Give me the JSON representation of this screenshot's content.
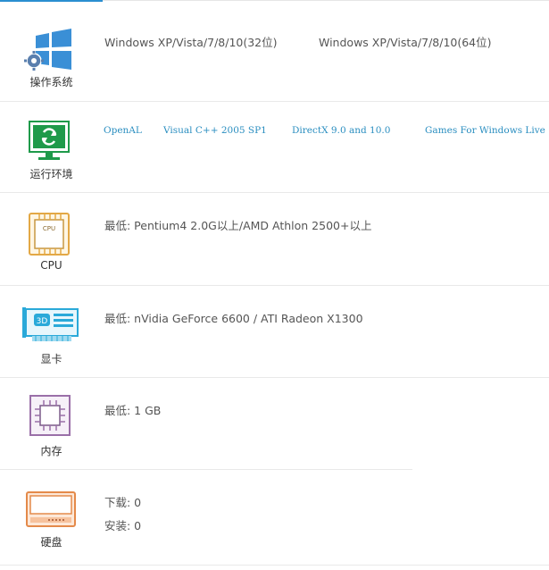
{
  "os": {
    "label": "操作系统",
    "values": [
      "Windows XP/Vista/7/8/10(32位)",
      "Windows XP/Vista/7/8/10(64位)"
    ]
  },
  "runtime": {
    "label": "运行环境",
    "links": [
      "OpenAL",
      "Visual C++ 2005 SP1",
      "DirectX 9.0 and 10.0",
      "Games For Windows Live"
    ]
  },
  "cpu": {
    "label": "CPU",
    "chip_text": "CPU",
    "value": "最低: Pentium4 2.0G以上/AMD Athlon 2500+以上"
  },
  "gpu": {
    "label": "显卡",
    "chip_text": "3D",
    "value": "最低: nVidia GeForce 6600 / ATI Radeon X1300"
  },
  "memory": {
    "label": "内存",
    "value": "最低: 1 GB"
  },
  "disk": {
    "label": "硬盘",
    "download": "下载: 0",
    "install": "安装: 0"
  },
  "colors": {
    "accent": "#2a8fd0",
    "link": "#2a8ec0",
    "os_icon": "#3a8fd6",
    "runtime_icon": "#1f9a4a",
    "cpu_icon": "#e3a845",
    "gpu_icon": "#2aa9d9",
    "memory_icon": "#9a6fa8",
    "disk_icon": "#e48a4a"
  }
}
